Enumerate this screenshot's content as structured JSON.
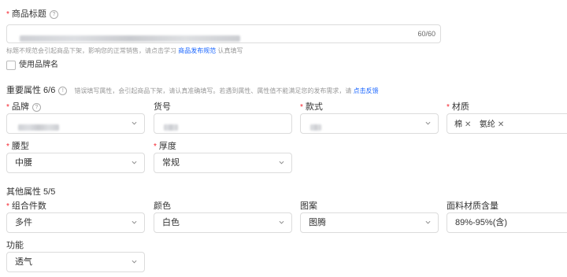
{
  "title_field": {
    "label": "商品标题",
    "counter": "60/60",
    "hint_prefix": "标题不规范会引起商品下架，影响您的正常销售，请点击学习",
    "hint_link": "商品发布规范",
    "hint_suffix": "认真填写",
    "use_brand_label": "使用品牌名",
    "use_brand_checked": false
  },
  "important_section": {
    "title": "重要属性 6/6",
    "hint_prefix": "错误填写属性，会引起商品下架，请认真准确填写。若遇到属性、属性值不能满足您的发布需求，请",
    "hint_link": "点击反馈"
  },
  "important_fields": [
    {
      "label": "品牌",
      "required": true,
      "has_help": true,
      "value": "",
      "type": "select"
    },
    {
      "label": "货号",
      "required": false,
      "has_help": false,
      "value": "",
      "type": "input"
    },
    {
      "label": "款式",
      "required": true,
      "has_help": false,
      "value": "",
      "type": "select"
    },
    {
      "label": "材质",
      "required": true,
      "has_help": false,
      "tags": [
        "棉",
        "氨纶"
      ],
      "type": "multiselect"
    },
    {
      "label": "腰型",
      "required": true,
      "has_help": false,
      "value": "中腰",
      "type": "select"
    },
    {
      "label": "厚度",
      "required": true,
      "has_help": false,
      "value": "常规",
      "type": "select"
    }
  ],
  "other_section": {
    "title": "其他属性 5/5"
  },
  "other_fields": [
    {
      "label": "组合件数",
      "required": true,
      "value": "多件"
    },
    {
      "label": "颜色",
      "required": false,
      "value": "白色"
    },
    {
      "label": "图案",
      "required": false,
      "value": "图腾"
    },
    {
      "label": "面料材质含量",
      "required": false,
      "value": "89%-95%(含)"
    },
    {
      "label": "功能",
      "required": false,
      "value": "透气"
    }
  ]
}
